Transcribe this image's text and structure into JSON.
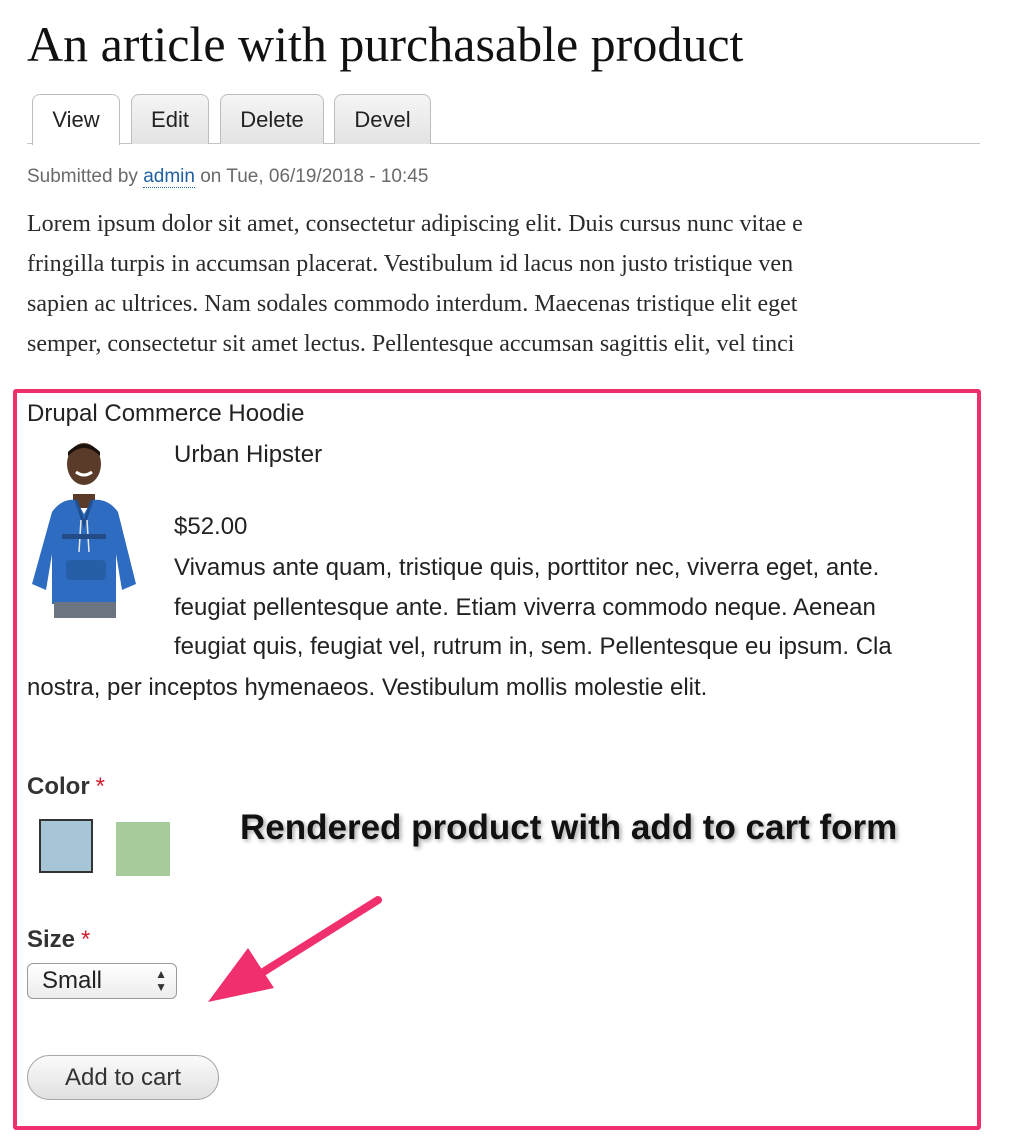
{
  "page": {
    "title": "An article with purchasable product"
  },
  "tabs": [
    {
      "label": "View",
      "active": true
    },
    {
      "label": "Edit",
      "active": false
    },
    {
      "label": "Delete",
      "active": false
    },
    {
      "label": "Devel",
      "active": false
    }
  ],
  "submitted": {
    "prefix": "Submitted by",
    "author": "admin",
    "suffix": "on Tue, 06/19/2018 - 10:45"
  },
  "body_lines": [
    "Lorem ipsum dolor sit amet, consectetur adipiscing elit. Duis cursus nunc vitae e",
    "fringilla turpis in accumsan placerat. Vestibulum id lacus non justo tristique ven",
    "sapien ac ultrices. Nam sodales commodo interdum. Maecenas tristique elit eget",
    "semper, consectetur sit amet lectus. Pellentesque accumsan sagittis elit, vel tinci"
  ],
  "product": {
    "title": "Drupal Commerce Hoodie",
    "brand": "Urban Hipster",
    "price": "$52.00",
    "description_lines": [
      "Vivamus ante quam, tristique quis, porttitor nec, viverra eget, ante.",
      "feugiat pellentesque ante. Etiam viverra commodo neque. Aenean",
      "feugiat quis, feugiat vel, rutrum in, sem. Pellentesque eu ipsum. Cla",
      "nostra, per inceptos hymenaeos. Vestibulum mollis molestie elit."
    ]
  },
  "form": {
    "color_label": "Color",
    "required_mark": "*",
    "colors": [
      {
        "name": "light blue",
        "hex": "#a6c5d7",
        "selected": true
      },
      {
        "name": "light green",
        "hex": "#a8cb9b",
        "selected": false
      }
    ],
    "size_label": "Size",
    "size_value": "Small",
    "add_to_cart_label": "Add to cart"
  },
  "annotation": {
    "text": "Rendered product with add to cart form",
    "highlight_color": "#f0306d"
  }
}
